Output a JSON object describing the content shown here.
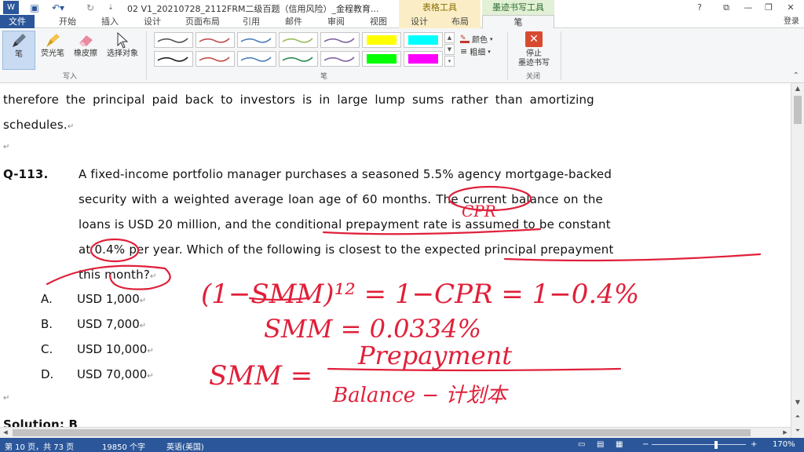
{
  "titlebar": {
    "document_title": "02 V1_20210728_2112FRM二级百题（信用风险）_金程教育...",
    "context_table": "表格工具",
    "context_ink": "墨迹书写工具",
    "help": "?",
    "login": "登录"
  },
  "menu": {
    "file": "文件",
    "home": "开始",
    "insert": "插入",
    "design": "设计",
    "layout": "页面布局",
    "references": "引用",
    "mailings": "邮件",
    "review": "审阅",
    "view": "视图",
    "table_design": "设计",
    "table_layout": "布局",
    "pen": "笔"
  },
  "ribbon": {
    "pen": "笔",
    "highlighter": "荧光笔",
    "eraser": "橡皮擦",
    "select_objects": "选择对象",
    "group_write": "写入",
    "group_pens": "笔",
    "color": "颜色",
    "weight": "粗细",
    "stop_inking_1": "停止",
    "stop_inking_2": "墨迹书写",
    "group_close": "关闭",
    "pen_colors": [
      "#555555",
      "#c0504d",
      "#4f81bd",
      "#9bbb59",
      "#8064a2",
      "#ffff00",
      "#00ffff",
      "#222222",
      "#c0504d",
      "#4f81bd",
      "#2e8b57",
      "#8064a2",
      "#00ff00",
      "#ff00ff"
    ]
  },
  "document": {
    "para1_line1": "therefore the principal paid back to investors is in large lump sums rather than amortizing",
    "para1_line2": "schedules.",
    "q_label": "Q-113.",
    "q_line1": "A fixed-income portfolio manager purchases a seasoned 5.5% agency mortgage-backed",
    "q_line2": "security with a weighted average loan age of 60 months. The current balance on the",
    "q_line3": "loans is USD 20 million, and the conditional prepayment rate is assumed to be constant",
    "q_line4": "at 0.4% per year. Which of the following is closest to the expected principal prepayment",
    "q_line5": "this month?",
    "options": [
      {
        "letter": "A.",
        "text": "USD 1,000"
      },
      {
        "letter": "B.",
        "text": "USD 7,000"
      },
      {
        "letter": "C.",
        "text": "USD 10,000"
      },
      {
        "letter": "D.",
        "text": "USD 70,000"
      }
    ],
    "solution": "Solution: B"
  },
  "handwriting": {
    "cpr_note": "CPR",
    "eq1": "(1−SMM)¹² = 1−CPR = 1−0.4%",
    "eq2": "SMM = 0.0334%",
    "eq3_lhs": "SMM =",
    "eq3_num": "Prepayment",
    "eq3_den": "Balance − 计划本",
    "ink_color": "#e0203a"
  },
  "status": {
    "page": "第 10 页，共 73 页",
    "words": "19850 个字",
    "language": "英语(美国)",
    "zoom": "170%"
  }
}
